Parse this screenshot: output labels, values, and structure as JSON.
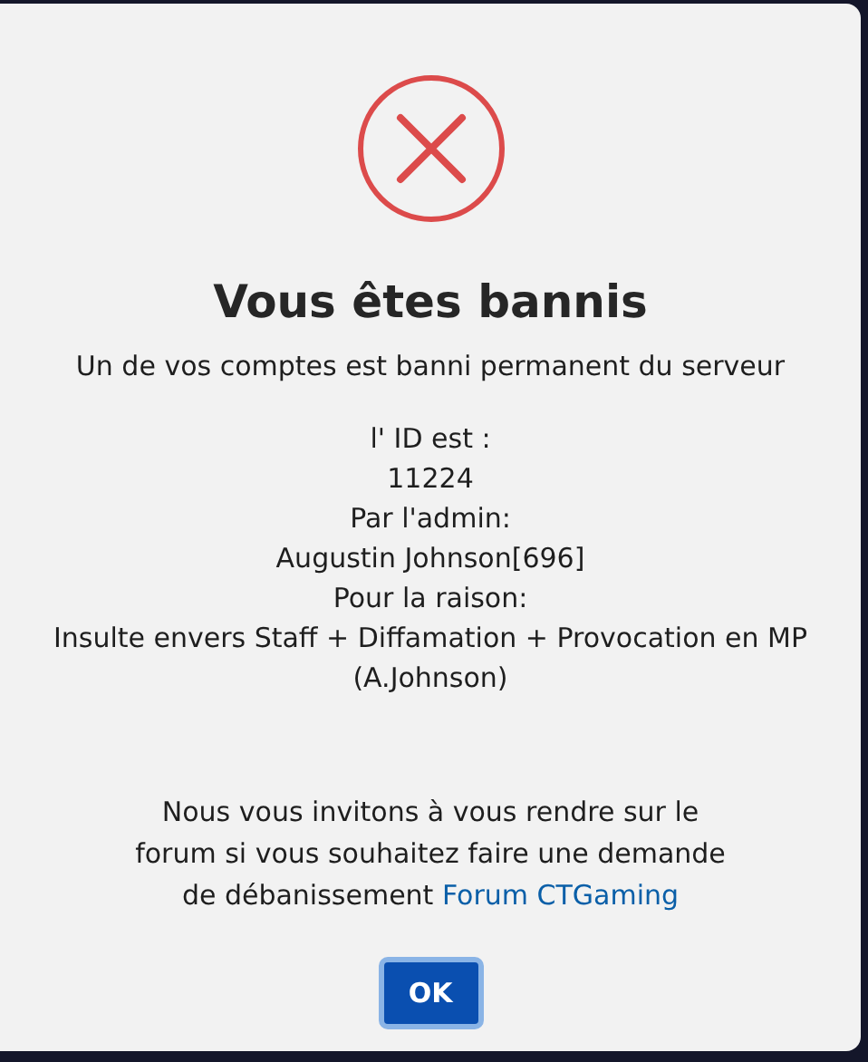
{
  "dialog": {
    "title": "Vous êtes bannis",
    "subtitle": "Un de vos comptes est banni permanent du serveur",
    "details": [
      "l' ID est :",
      "11224",
      "Par l'admin:",
      "Augustin Johnson[696]",
      "Pour la raison:",
      "Insulte envers Staff + Diffamation + Provocation en MP (A.Johnson)"
    ],
    "footer": {
      "text": "Nous vous invitons à vous rendre sur le forum si vous souhaitez faire une demande de débanissement",
      "link": "Forum CTGaming"
    },
    "buttons": [
      "OK"
    ]
  }
}
